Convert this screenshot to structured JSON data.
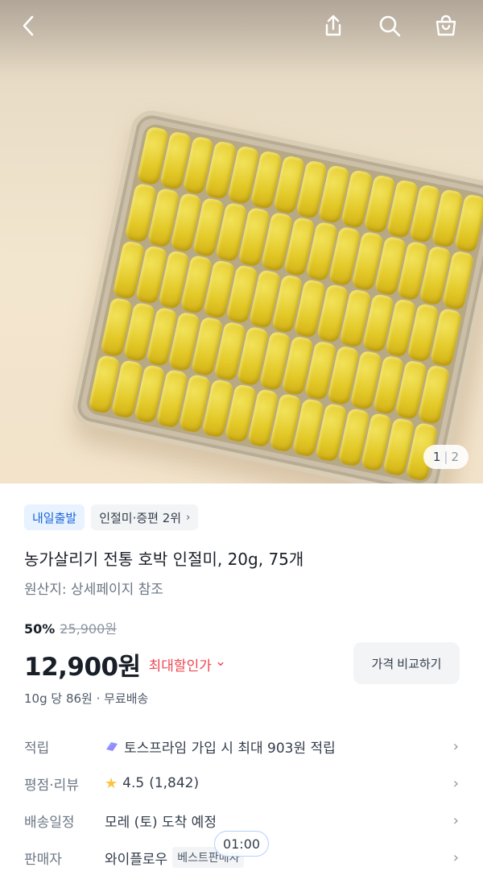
{
  "pager": {
    "current": "1",
    "separator": "|",
    "total": "2"
  },
  "icons": {
    "back": "back-arrow-icon",
    "share": "share-icon",
    "search": "search-icon",
    "cart": "shopping-bag-icon"
  },
  "chips": {
    "shipping": "내일출발",
    "rank": "인절미·증편 2위",
    "rank_chevron": "›"
  },
  "product": {
    "title": "농가살리기 전통 호박 인절미, 20g, 75개",
    "origin": "원산지: 상세페이지 참조"
  },
  "pricing": {
    "discount": "50%",
    "original_price": "25,900원",
    "price": "12,900원",
    "max_discount_label": "최대할인가",
    "max_discount_chevron": "⌄",
    "compare_button": "가격 비교하기",
    "unit_info": "10g 당 86원 · 무료배송"
  },
  "details": {
    "points": {
      "label": "적립",
      "value": "토스프라임 가입 시 최대 903원 적립"
    },
    "rating": {
      "label": "평점·리뷰",
      "score": "4.5",
      "count": "(1,842)"
    },
    "delivery": {
      "label": "배송일정",
      "value": "모레 (토) 도착 예정"
    },
    "seller": {
      "label": "판매자",
      "value": "와이플로우",
      "badge": "베스트판매자"
    },
    "chevron": "›"
  },
  "timer": "01:00",
  "colors": {
    "accent_blue": "#1b64da",
    "discount_red": "#f04452",
    "star": "#ffc342"
  }
}
